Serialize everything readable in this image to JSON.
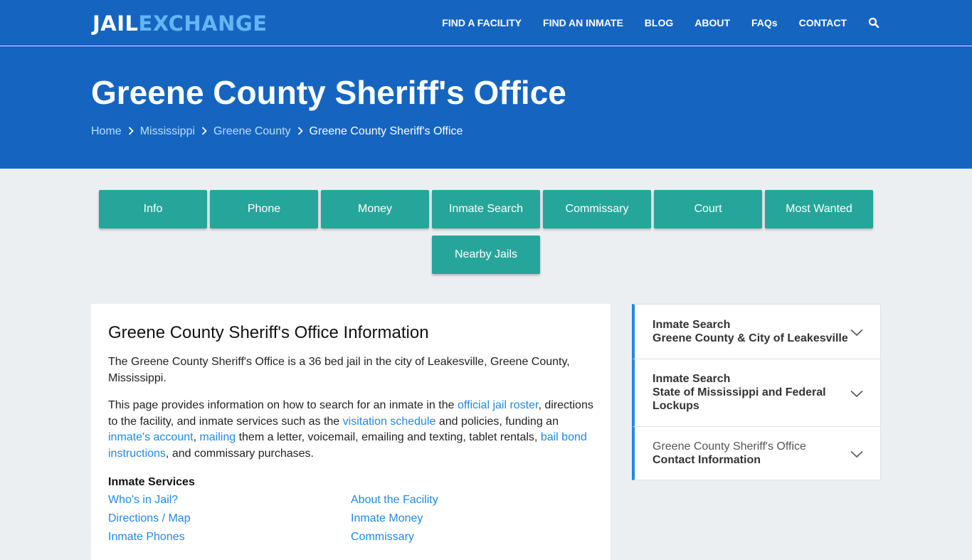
{
  "brand": {
    "part1": "JAIL",
    "part2": "EXCHANGE"
  },
  "nav": [
    {
      "label": "FIND A FACILITY"
    },
    {
      "label": "FIND AN INMATE"
    },
    {
      "label": "BLOG"
    },
    {
      "label": "ABOUT"
    },
    {
      "label": "FAQs"
    },
    {
      "label": "CONTACT"
    }
  ],
  "icons": {
    "search": "search-icon",
    "chevron": "chevron-down-icon",
    "breadcrumb_sep": "chevron-right-icon"
  },
  "hero": {
    "title": "Greene County Sheriff's Office",
    "breadcrumb": [
      "Home",
      "Mississippi",
      "Greene County",
      "Greene County Sheriff's Office"
    ]
  },
  "tabs": [
    "Info",
    "Phone",
    "Money",
    "Inmate Search",
    "Commissary",
    "Court",
    "Most Wanted",
    "Nearby Jails"
  ],
  "info": {
    "heading": "Greene County Sheriff's Office Information",
    "para1": "The Greene County Sheriff's Office is a 36 bed jail in the city of Leakesville, Greene County, Mississippi.",
    "para2": {
      "t1": "This page provides information on how to search for an inmate in the ",
      "link1": "official jail roster",
      "t2": ", directions to the facility, and inmate services such as the ",
      "link2": "visitation schedule",
      "t3": " and policies, funding an ",
      "link3": "inmate's account",
      "t4": ", ",
      "link4": "mailing",
      "t5": " them a letter, voicemail, emailing and texting, tablet rentals, ",
      "link5": "bail bond instructions",
      "t6": ", and commissary purchases."
    },
    "services_title": "Inmate Services",
    "services_left": [
      "Who's in Jail?",
      "Directions / Map",
      "Inmate Phones"
    ],
    "services_right": [
      "About the Facility",
      "Inmate Money",
      "Commissary"
    ]
  },
  "sidebar": [
    {
      "line1": "Inmate Search",
      "line2": "Greene County & City of Leakesville"
    },
    {
      "line1": "Inmate Search",
      "line2": "State of Mississippi and Federal",
      "line3": "Lockups"
    },
    {
      "line1": "Greene County Sheriff's Office",
      "line2": "Contact Information"
    }
  ],
  "colors": {
    "header": "#1565c0",
    "tab": "#26a69a",
    "link": "#1e88e5",
    "accent": "#64b5f6"
  }
}
